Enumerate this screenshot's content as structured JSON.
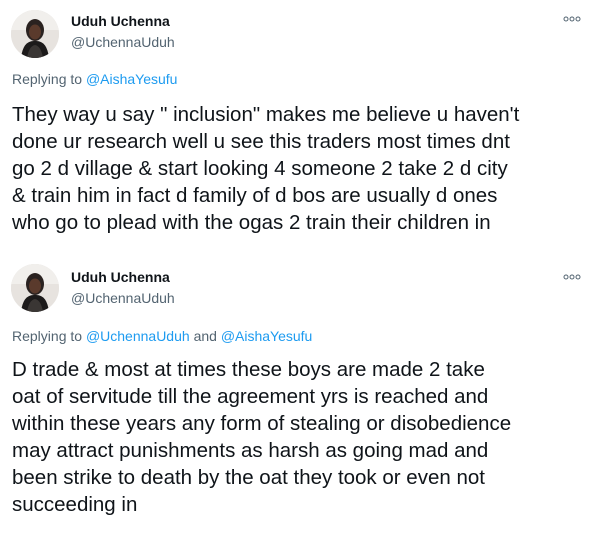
{
  "tweets": [
    {
      "author_name": "Uduh Uchenna",
      "author_handle": "@UchennaUduh",
      "replying_prefix": "Replying to",
      "replying_to": [
        "@AishaYesufu"
      ],
      "replying_joiner": "",
      "text_lines": [
        "They way u say \" inclusion\" makes me believe u haven't",
        "done ur research well u see this traders most times dnt",
        "go 2 d village & start looking 4 someone 2 take 2 d city",
        "& train him in fact d family of d bos are usually d ones",
        "who go to plead with the ogas 2 train their children in"
      ]
    },
    {
      "author_name": "Uduh Uchenna",
      "author_handle": "@UchennaUduh",
      "replying_prefix": "Replying to",
      "replying_to": [
        "@UchennaUduh",
        "@AishaYesufu"
      ],
      "replying_joiner": "and",
      "text_lines": [
        "D trade & most at times these boys are made 2 take",
        "oat of servitude till the agreement yrs is reached and",
        "within these years any form of stealing or disobedience",
        "may attract punishments as harsh as going mad and",
        "been strike to death by the oat they took or even not",
        "succeeding in"
      ]
    }
  ],
  "icons": {
    "more": "more-options-icon",
    "avatar": "avatar-photo"
  },
  "colors": {
    "text": "#0f1419",
    "secondary": "#536471",
    "link": "#1d9bf0"
  }
}
